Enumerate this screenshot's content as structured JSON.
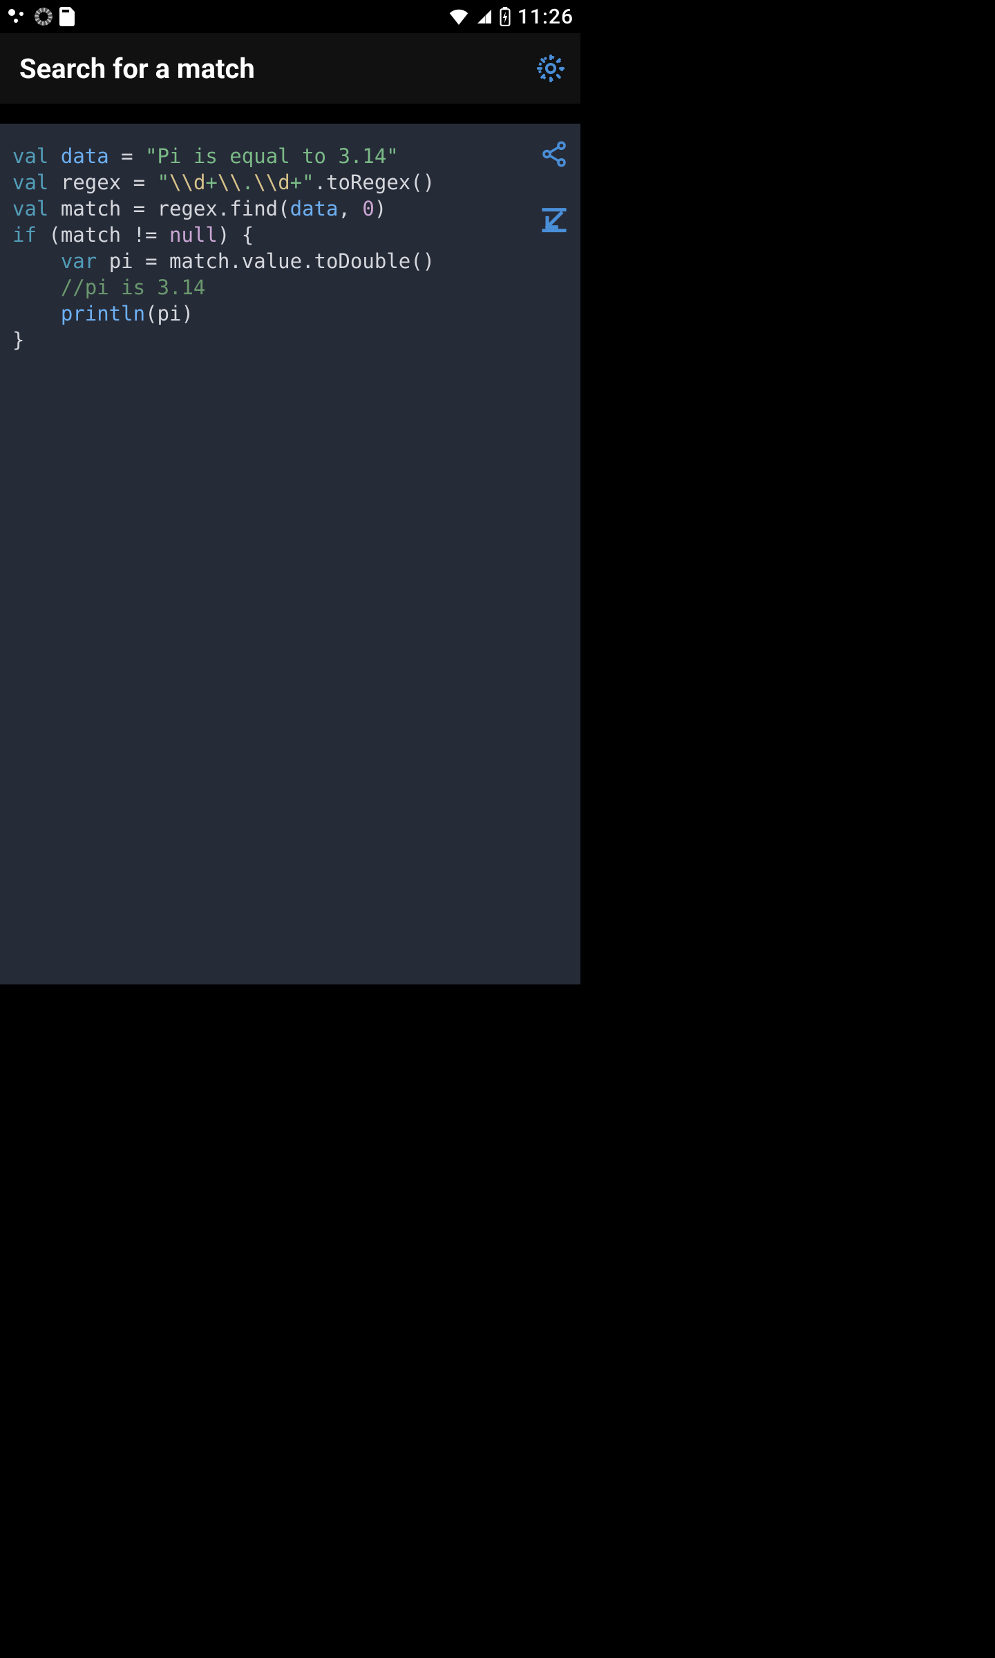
{
  "status_bar": {
    "clock": "11:26"
  },
  "app_bar": {
    "title": "Search for a match"
  },
  "code": {
    "lines": [
      {
        "t": [
          {
            "c": "kw",
            "v": "val"
          },
          {
            "c": "pun",
            "v": " "
          },
          {
            "c": "hl",
            "v": "data"
          },
          {
            "c": "pun",
            "v": " = "
          },
          {
            "c": "str",
            "v": "\"Pi is equal to 3.14\""
          }
        ]
      },
      {
        "t": [
          {
            "c": "kw",
            "v": "val"
          },
          {
            "c": "pun",
            "v": " "
          },
          {
            "c": "id",
            "v": "regex"
          },
          {
            "c": "pun",
            "v": " = "
          },
          {
            "c": "str",
            "v": "\""
          },
          {
            "c": "esc",
            "v": "\\\\d"
          },
          {
            "c": "str",
            "v": "+"
          },
          {
            "c": "esc",
            "v": "\\\\"
          },
          {
            "c": "str",
            "v": "."
          },
          {
            "c": "esc",
            "v": "\\\\d"
          },
          {
            "c": "str",
            "v": "+\""
          },
          {
            "c": "pun",
            "v": ".toRegex()"
          }
        ]
      },
      {
        "t": [
          {
            "c": "kw",
            "v": "val"
          },
          {
            "c": "pun",
            "v": " "
          },
          {
            "c": "id",
            "v": "match"
          },
          {
            "c": "pun",
            "v": " = regex.find("
          },
          {
            "c": "hl",
            "v": "data"
          },
          {
            "c": "pun",
            "v": ", "
          },
          {
            "c": "num",
            "v": "0"
          },
          {
            "c": "pun",
            "v": ")"
          }
        ]
      },
      {
        "t": [
          {
            "c": "kw",
            "v": "if"
          },
          {
            "c": "pun",
            "v": " (match != "
          },
          {
            "c": "null",
            "v": "null"
          },
          {
            "c": "pun",
            "v": ") {"
          }
        ]
      },
      {
        "t": [
          {
            "c": "pun",
            "v": "    "
          },
          {
            "c": "kw",
            "v": "var"
          },
          {
            "c": "pun",
            "v": " "
          },
          {
            "c": "id",
            "v": "pi"
          },
          {
            "c": "pun",
            "v": " = match.value.toDouble()"
          }
        ]
      },
      {
        "t": [
          {
            "c": "pun",
            "v": "    "
          },
          {
            "c": "cmt",
            "v": "//pi is 3.14"
          }
        ]
      },
      {
        "t": [
          {
            "c": "pun",
            "v": "    "
          },
          {
            "c": "hl",
            "v": "println"
          },
          {
            "c": "pun",
            "v": "(pi)"
          }
        ]
      },
      {
        "t": [
          {
            "c": "pun",
            "v": "}"
          }
        ]
      }
    ]
  },
  "icons": {
    "settings": "gear-icon",
    "share": "share-icon",
    "collapse": "collapse-icon"
  },
  "colors": {
    "accent": "#4a8fd8",
    "code_bg": "#262b38",
    "app_bar_bg": "#111111"
  }
}
